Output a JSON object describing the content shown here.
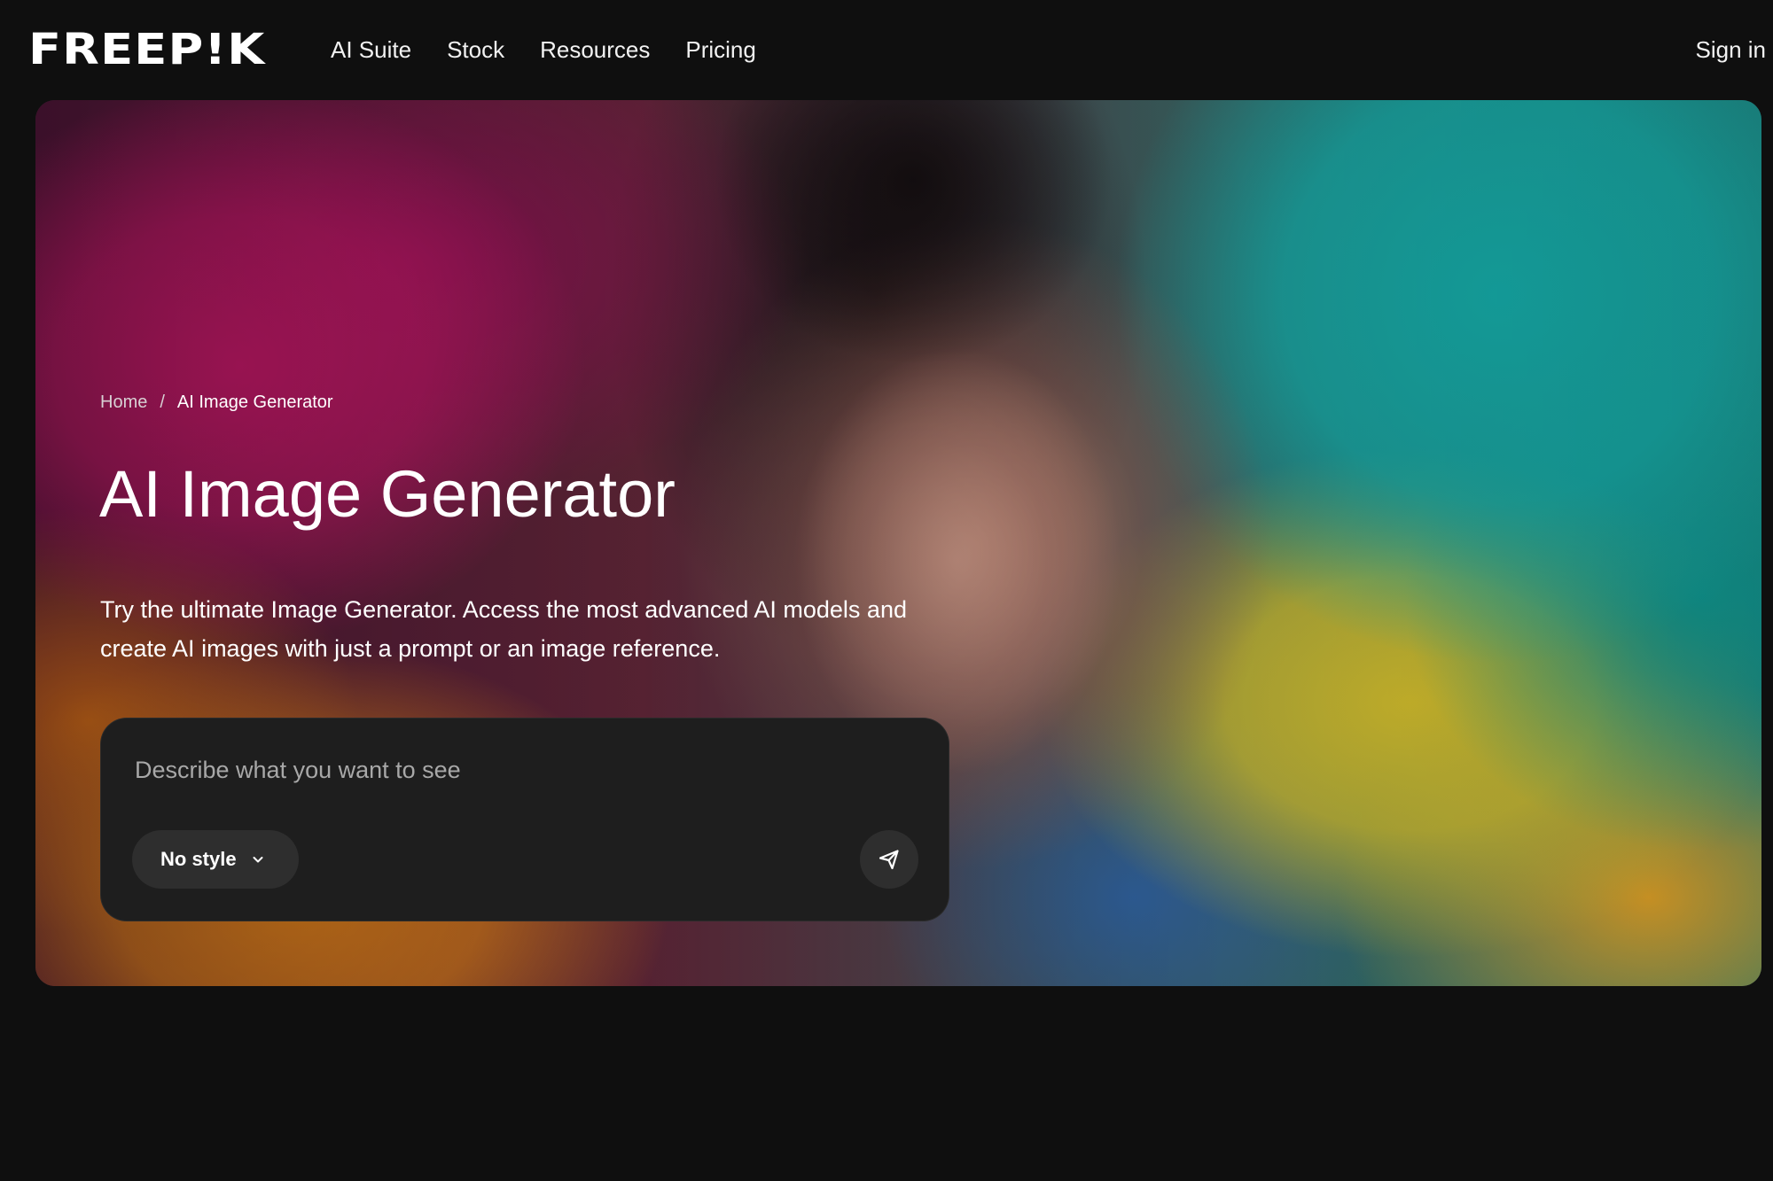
{
  "header": {
    "logo_text": "FREEP!K",
    "nav": [
      {
        "label": "AI Suite"
      },
      {
        "label": "Stock"
      },
      {
        "label": "Resources"
      },
      {
        "label": "Pricing"
      }
    ],
    "signin_label": "Sign in"
  },
  "hero": {
    "breadcrumb": {
      "home": "Home",
      "separator": "/",
      "current": "AI Image Generator"
    },
    "title": "AI Image Generator",
    "description": "Try the ultimate Image Generator. Access the most advanced AI models and create AI images with just a prompt or an image reference.",
    "prompt": {
      "placeholder": "Describe what you want to see",
      "value": "",
      "style_label": "No style"
    }
  },
  "icons": {
    "style_chevron": "chevron-down-icon",
    "send": "send-icon"
  },
  "colors": {
    "page_background": "#0f0f0f",
    "prompt_background": "#1e1e1e",
    "pill_background": "#2e2e2e",
    "text": "#ffffff"
  }
}
